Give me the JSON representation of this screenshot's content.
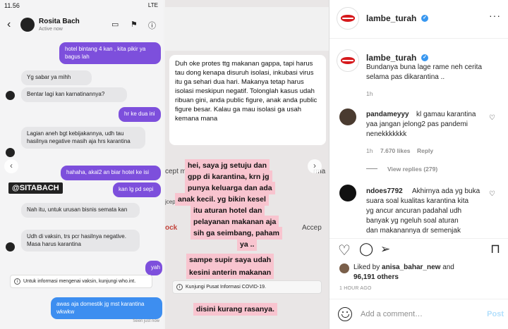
{
  "screenshot1": {
    "status_time": "11.56",
    "status_right": "LTE",
    "chat_name": "Rosita Bach",
    "chat_status": "Active now",
    "messages": [
      {
        "side": "out",
        "text": "hotel bintang 4 kan , kita pikir ya bagus lah"
      },
      {
        "side": "in",
        "text": "Yg sabar ya mihh"
      },
      {
        "side": "in",
        "text": "Bentar lagi kan karnatinannya?"
      },
      {
        "side": "out",
        "text": "hr ke dua ini"
      },
      {
        "side": "in",
        "text": "Lagian aneh bgt kebijakannya, udh tau hasilnya negative masih aja hrs karantina"
      },
      {
        "side": "out",
        "text": "hahaha, akal2 an biar hotel ke isi"
      },
      {
        "side": "out",
        "text": "kan lg pd sepi"
      },
      {
        "side": "in",
        "text": "Nah itu, untuk urusan bisnis semata kan"
      },
      {
        "side": "in",
        "text": "Udh di vaksin, trs pcr hasilnya negative. Masa harus karantina"
      },
      {
        "side": "out",
        "text": "yah"
      },
      {
        "side": "out",
        "text": "awas aja domestik jg mst karantina wkwkw"
      }
    ],
    "sticker": "@SITABACH",
    "covid_text": "Untuk informasi mengenai vaksin, kunjungi who.int.",
    "seen": "Seen just now"
  },
  "screenshot2": {
    "note_text": "Duh oke protes ttg makanan gappa, tapi harus tau dong kenapa disuruh isolasi, inkubasi virus itu ga sehari dua hari. Makanya tetap harus isolasi meskipun negatif. Tolonglah kasus udah ribuan gini, anda public figure, anak anda public figure besar.  Kalau ga mau isolasi ga usah kemana mana",
    "caption_lines": [
      "hei, saya jg setuju dan",
      "gpp di karantina, krn jg",
      "punya keluarga dan ada",
      "anak kecil. yg bikin kesel",
      "itu aturan hotel dan",
      "pelayanan makanan aja",
      "sih ga seimbang, paham",
      "ya ..",
      "sampe supir saya udah",
      "kesini anterin makanan",
      "disini kurang rasanya."
    ],
    "covid_text": "Kunjungi Pusat Informasi COVID-19.",
    "ghost_left": "cept m",
    "ghost_right": "rma",
    "ghost_block": "ock",
    "ghost_accept": "Accep",
    "ghost_small": "jcept"
  },
  "sidebar": {
    "header_username": "lambe_turah",
    "more_icon": "more-dots",
    "caption": {
      "username": "lambe_turah",
      "text_line1": "Bundanya buna lage rame neh cerita",
      "text_line2": "selama pas dikarantina ..",
      "age": "1h"
    },
    "comments": [
      {
        "username": "pandameyyy",
        "text_line1": "kl gamau karantina",
        "text_line2": "yaa jangan jelong2 pas pandemi",
        "text_line3": "nenekkkkkkk",
        "age": "1h",
        "likes": "7.670 likes",
        "reply": "Reply",
        "view_replies": "View replies (279)"
      },
      {
        "username": "ndoes7792",
        "text_line1": "Akhirnya ada yg buka",
        "text_line2": "suara soal kualitas karantina kita",
        "text_line3": "yg ancur ancuran padahal udh",
        "text_line4": "banyak yg ngeluh soal aturan",
        "text_line5": "dan makanannya dr semenjak"
      }
    ],
    "liked_prefix": "Liked by",
    "liked_user": "anisa_bahar_new",
    "liked_and": "and",
    "liked_others": "96,191 others",
    "timestamp": "1 HOUR AGO",
    "comment_placeholder": "Add a comment…",
    "post_label": "Post"
  }
}
